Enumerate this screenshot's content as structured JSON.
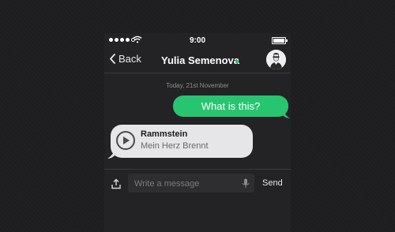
{
  "status_bar": {
    "time": "9:00",
    "signal_dots_filled": 4,
    "signal_dots_total": 5,
    "battery_level": 1.0
  },
  "nav": {
    "back_label": "Back",
    "contact_name": "Yulia Semenova",
    "online": true,
    "online_color": "#27c37a"
  },
  "conversation": {
    "date_label": "Today, 21st November",
    "messages": [
      {
        "direction": "outgoing",
        "type": "text",
        "text": "What is this?",
        "color": "#27c56f"
      },
      {
        "direction": "incoming",
        "type": "audio",
        "title": "Rammstein",
        "subtitle": "Mein Herz Brennt",
        "icon": "play-icon"
      }
    ]
  },
  "composer": {
    "placeholder": "Write a message",
    "value": "",
    "send_label": "Send",
    "left_icon": "upload-icon",
    "right_icon": "microphone-icon"
  }
}
